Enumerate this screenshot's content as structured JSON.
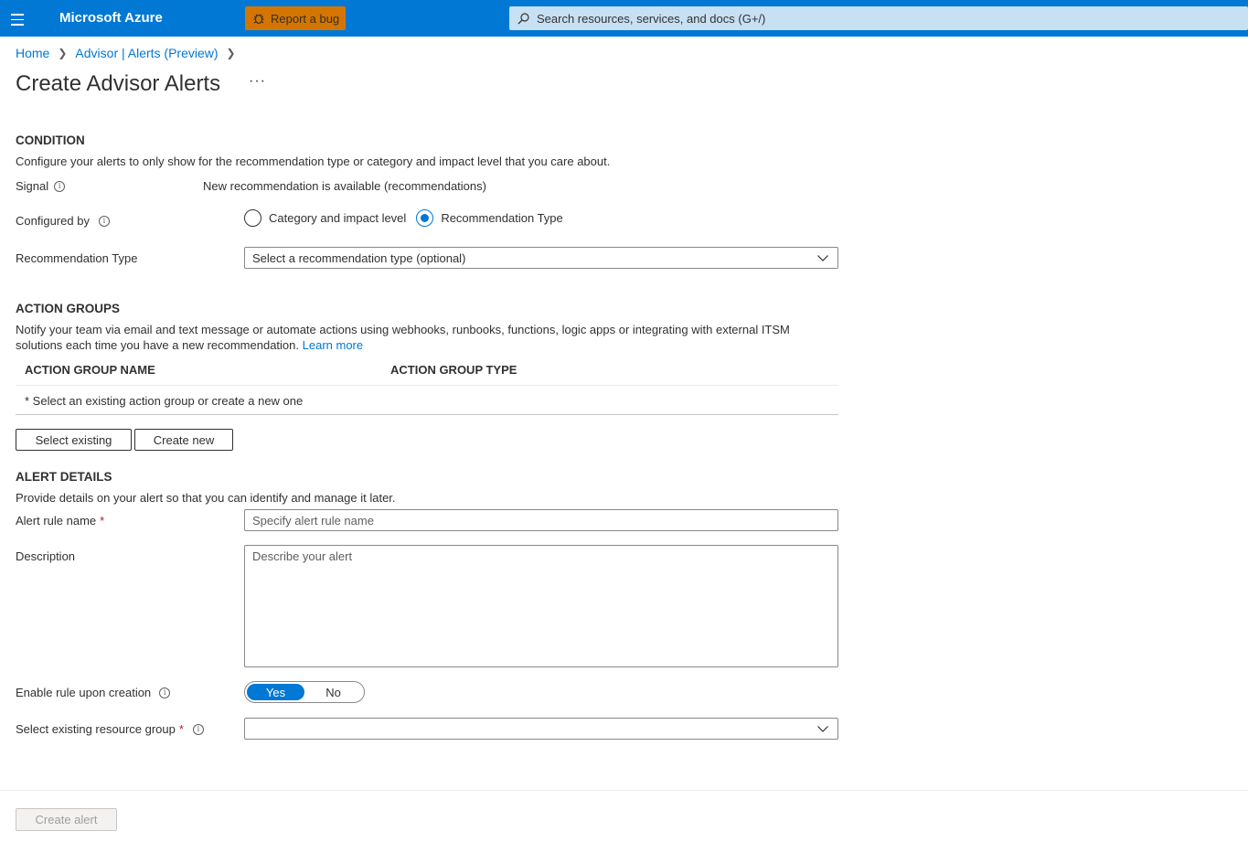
{
  "header": {
    "brand": "Microsoft Azure",
    "report_bug_label": "Report a bug",
    "search_placeholder": "Search resources, services, and docs (G+/)"
  },
  "breadcrumb": {
    "items": [
      "Home",
      "Advisor | Alerts (Preview)"
    ]
  },
  "page": {
    "title": "Create Advisor Alerts",
    "more_label": "···"
  },
  "condition": {
    "title": "CONDITION",
    "description": "Configure your alerts to only show for the recommendation type or category and impact level that you care about.",
    "signal_label": "Signal",
    "signal_value": "New recommendation is available (recommendations)",
    "configured_by_label": "Configured by",
    "options": [
      "Category and impact level",
      "Recommendation Type"
    ],
    "selected_option": "Recommendation Type",
    "recommendation_type_label": "Recommendation Type",
    "recommendation_type_placeholder": "Select a recommendation type (optional)"
  },
  "action_groups": {
    "title": "ACTION GROUPS",
    "description": "Notify your team via email and text message or automate actions using webhooks, runbooks, functions, logic apps or integrating with external ITSM",
    "description_line2": "solutions each time you have a new recommendation.",
    "learn_more": "Learn more",
    "columns": [
      "ACTION GROUP NAME",
      "ACTION GROUP TYPE"
    ],
    "empty_row": "* Select an existing action group or create a new one",
    "select_existing_label": "Select existing",
    "create_new_label": "Create new"
  },
  "alert_details": {
    "title": "ALERT DETAILS",
    "description": "Provide details on your alert so that you can identify and manage it later.",
    "rule_name_label": "Alert rule name",
    "rule_name_placeholder": "Specify alert rule name",
    "description_label": "Description",
    "description_placeholder": "Describe your alert",
    "enable_label": "Enable rule upon creation",
    "toggle_yes": "Yes",
    "toggle_no": "No",
    "enabled": true,
    "resource_group_label": "Select existing resource group",
    "resource_group_value": ""
  },
  "footer": {
    "create_label": "Create alert"
  },
  "colors": {
    "accent": "#0078d4",
    "bug_button": "#d47500",
    "search_bg": "#c7e0f4",
    "required": "#a4262c"
  }
}
